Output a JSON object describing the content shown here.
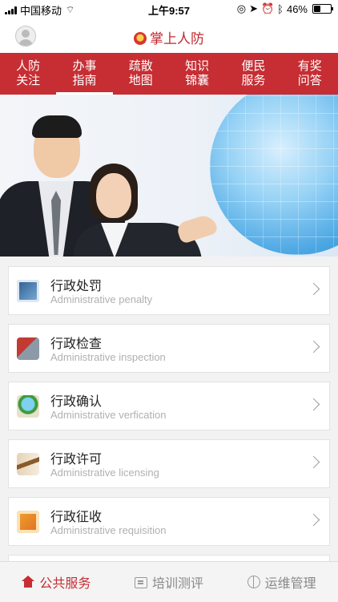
{
  "status_bar": {
    "carrier": "中国移动",
    "time": "上午9:57",
    "battery": "46%",
    "battery_level": 0.46
  },
  "header": {
    "title": "掌上人防"
  },
  "tabs": [
    {
      "label": "人防关注",
      "active": false
    },
    {
      "label": "办事指南",
      "active": true
    },
    {
      "label": "疏散地图",
      "active": false
    },
    {
      "label": "知识锦囊",
      "active": false
    },
    {
      "label": "便民服务",
      "active": false
    },
    {
      "label": "有奖问答",
      "active": false
    }
  ],
  "services": [
    {
      "title": "行政处罚",
      "subtitle": "Administrative penalty",
      "icon": "penalty-icon"
    },
    {
      "title": "行政检查",
      "subtitle": "Administrative inspection",
      "icon": "inspection-icon"
    },
    {
      "title": "行政确认",
      "subtitle": "Administrative verfication",
      "icon": "verification-icon"
    },
    {
      "title": "行政许可",
      "subtitle": "Administrative licensing",
      "icon": "licensing-icon"
    },
    {
      "title": "行政征收",
      "subtitle": "Administrative requisition",
      "icon": "requisition-icon"
    }
  ],
  "bottom_nav": [
    {
      "label": "公共服务",
      "active": true,
      "icon": "home-icon"
    },
    {
      "label": "培训测评",
      "active": false,
      "icon": "training-icon"
    },
    {
      "label": "运维管理",
      "active": false,
      "icon": "maintenance-icon"
    }
  ],
  "colors": {
    "brand_red": "#c62e33",
    "subtitle_gray": "#b0b0b0"
  }
}
